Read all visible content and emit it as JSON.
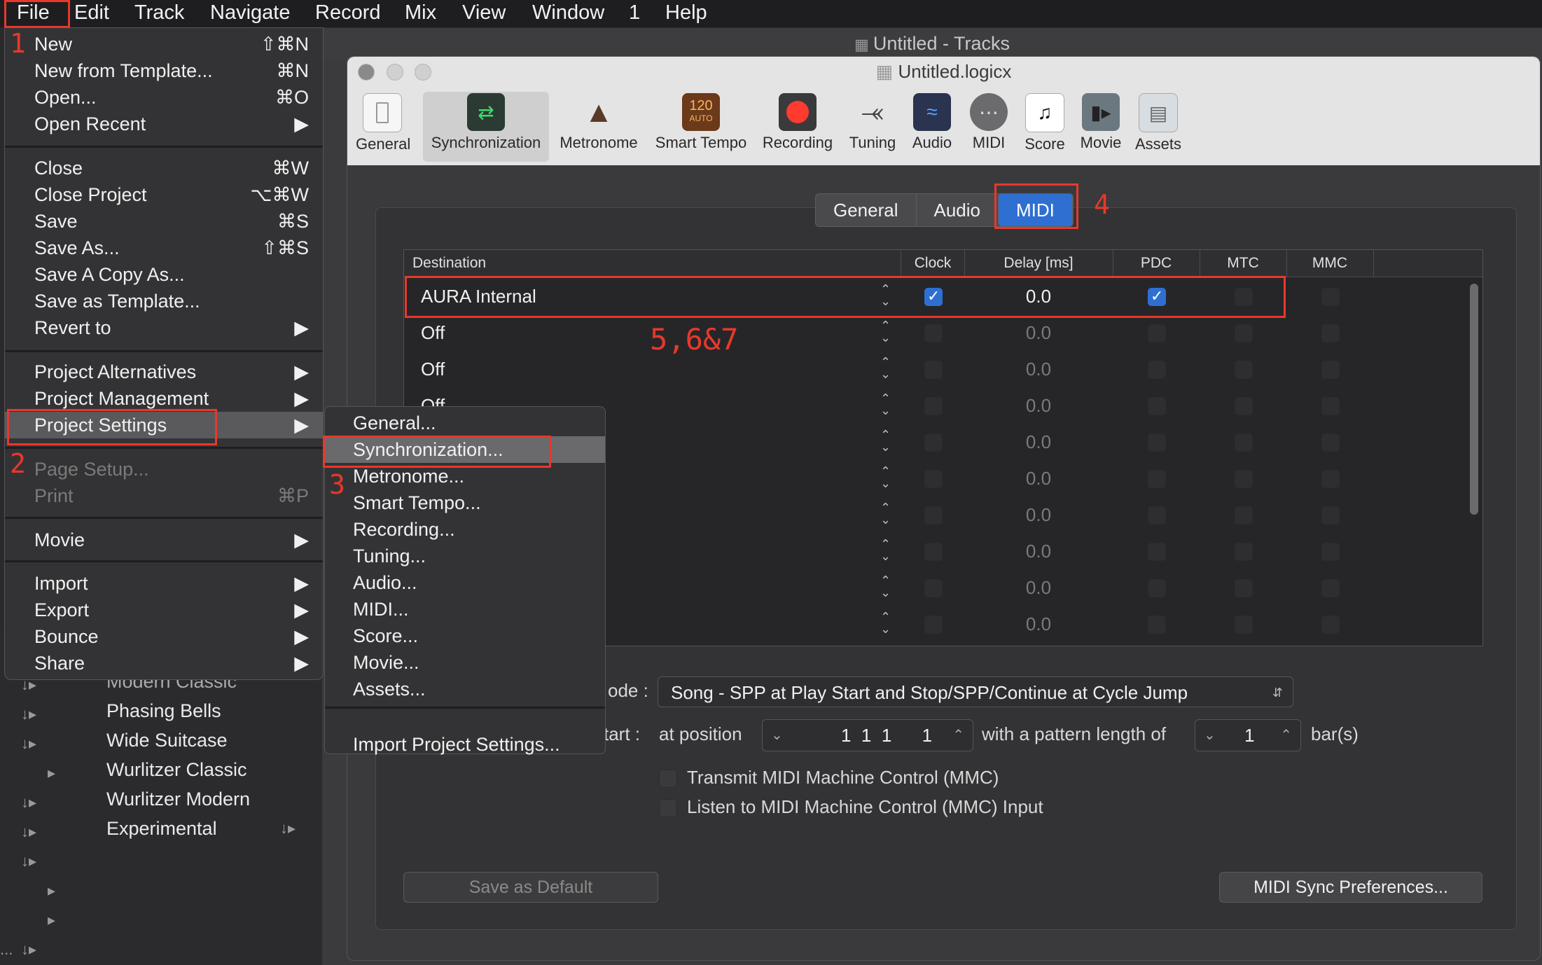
{
  "menubar": {
    "items": [
      "File",
      "Edit",
      "Track",
      "Navigate",
      "Record",
      "Mix",
      "View",
      "Window",
      "1",
      "Help"
    ]
  },
  "tracks_window": {
    "title": "Untitled - Tracks"
  },
  "library": {
    "items": [
      "Modern Classic",
      "Phasing Bells",
      "Wide Suitcase",
      "Wurlitzer Classic",
      "Wurlitzer Modern",
      "Experimental"
    ],
    "footer": "..."
  },
  "settings_window": {
    "title": "Untitled.logicx",
    "toolbar": [
      "General",
      "Synchronization",
      "Metronome",
      "Smart Tempo",
      "Recording",
      "Tuning",
      "Audio",
      "MIDI",
      "Score",
      "Movie",
      "Assets"
    ],
    "smart_tempo_icon_text": [
      "120",
      "AUTO"
    ],
    "active_toolbar": "Synchronization",
    "tabs": [
      "General",
      "Audio",
      "MIDI"
    ],
    "active_tab": "MIDI",
    "table": {
      "headers": [
        "Destination",
        "Clock",
        "Delay [ms]",
        "PDC",
        "MTC",
        "MMC"
      ],
      "rows": [
        {
          "destination": "AURA Internal",
          "clock": true,
          "delay": "0.0",
          "pdc": true,
          "mtc": false,
          "mmc": false
        },
        {
          "destination": "Off",
          "clock": false,
          "delay": "0.0",
          "pdc": false,
          "mtc": false,
          "mmc": false
        },
        {
          "destination": "Off",
          "clock": false,
          "delay": "0.0",
          "pdc": false,
          "mtc": false,
          "mmc": false
        },
        {
          "destination": "Off",
          "clock": false,
          "delay": "0.0",
          "pdc": false,
          "mtc": false,
          "mmc": false
        },
        {
          "destination": "",
          "clock": false,
          "delay": "0.0",
          "pdc": false,
          "mtc": false,
          "mmc": false
        },
        {
          "destination": "",
          "clock": false,
          "delay": "0.0",
          "pdc": false,
          "mtc": false,
          "mmc": false
        },
        {
          "destination": "",
          "clock": false,
          "delay": "0.0",
          "pdc": false,
          "mtc": false,
          "mmc": false
        },
        {
          "destination": "",
          "clock": false,
          "delay": "0.0",
          "pdc": false,
          "mtc": false,
          "mmc": false
        },
        {
          "destination": "",
          "clock": false,
          "delay": "0.0",
          "pdc": false,
          "mtc": false,
          "mmc": false
        },
        {
          "destination": "",
          "clock": false,
          "delay": "0.0",
          "pdc": false,
          "mtc": false,
          "mmc": false
        }
      ]
    },
    "mode_label": "ode :",
    "mode_value": "Song - SPP at Play Start and Stop/SPP/Continue at Cycle Jump",
    "start_label": "tart :",
    "at_position_label": "at position",
    "position_value": "1  1  1      1",
    "pattern_label": "with a pattern length of",
    "pattern_value": "1",
    "bars_label": "bar(s)",
    "transmit_mmc": "Transmit MIDI Machine Control (MMC)",
    "listen_mmc": "Listen to MIDI Machine Control (MMC) Input",
    "save_default": "Save as Default",
    "sync_prefs": "MIDI Sync Preferences..."
  },
  "file_menu": {
    "items": [
      {
        "label": "New",
        "shortcut": "⇧⌘N"
      },
      {
        "label": "New from Template...",
        "shortcut": "⌘N"
      },
      {
        "label": "Open...",
        "shortcut": "⌘O"
      },
      {
        "label": "Open Recent",
        "shortcut": "▶"
      },
      {
        "label": "Close",
        "shortcut": "⌘W"
      },
      {
        "label": "Close Project",
        "shortcut": "⌥⌘W"
      },
      {
        "label": "Save",
        "shortcut": "⌘S"
      },
      {
        "label": "Save As...",
        "shortcut": "⇧⌘S"
      },
      {
        "label": "Save A Copy As...",
        "shortcut": ""
      },
      {
        "label": "Save as Template...",
        "shortcut": ""
      },
      {
        "label": "Revert to",
        "shortcut": "▶"
      },
      {
        "label": "Project Alternatives",
        "shortcut": "▶"
      },
      {
        "label": "Project Management",
        "shortcut": "▶"
      },
      {
        "label": "Project Settings",
        "shortcut": "▶"
      },
      {
        "label": "Page Setup...",
        "shortcut": ""
      },
      {
        "label": "Print",
        "shortcut": "⌘P"
      },
      {
        "label": "Movie",
        "shortcut": "▶"
      },
      {
        "label": "Import",
        "shortcut": "▶"
      },
      {
        "label": "Export",
        "shortcut": "▶"
      },
      {
        "label": "Bounce",
        "shortcut": "▶"
      },
      {
        "label": "Share",
        "shortcut": "▶"
      }
    ]
  },
  "project_settings_submenu": {
    "items": [
      "General...",
      "Synchronization...",
      "Metronome...",
      "Smart Tempo...",
      "Recording...",
      "Tuning...",
      "Audio...",
      "MIDI...",
      "Score...",
      "Movie...",
      "Assets...",
      "Import Project Settings..."
    ]
  },
  "annotations": [
    "1",
    "2",
    "3",
    "4",
    "5,6&7"
  ],
  "colors": {
    "accent": "#2f6fd1",
    "annotation": "#e8382c"
  }
}
